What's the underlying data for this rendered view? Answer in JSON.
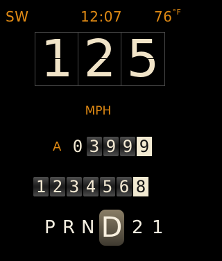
{
  "status": {
    "compass": "SW",
    "time": "12:07",
    "temperature": "76",
    "temp_unit": "°F"
  },
  "speed": {
    "digits": [
      "1",
      "2",
      "5"
    ],
    "unit": "MPH"
  },
  "trip": {
    "label": "A",
    "digits": [
      "0",
      "3",
      "9",
      "9",
      "9"
    ]
  },
  "odometer": {
    "digits": [
      "1",
      "2",
      "3",
      "4",
      "5",
      "6",
      "8"
    ]
  },
  "gear": {
    "options": [
      "P",
      "R",
      "N",
      "D",
      "2",
      "1"
    ],
    "active": "D"
  },
  "colors": {
    "accent": "#e08a14",
    "digit": "#f1e4c8",
    "background": "#000000"
  }
}
